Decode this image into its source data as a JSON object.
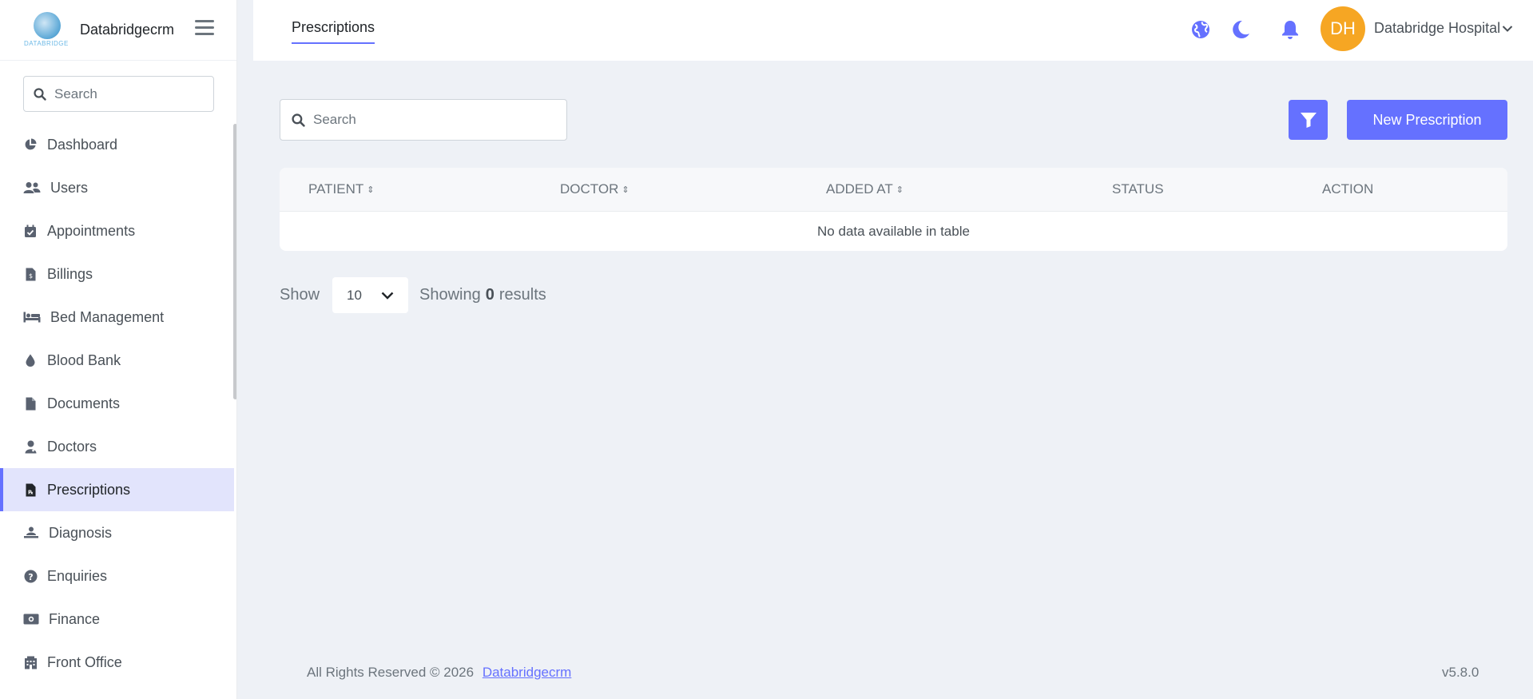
{
  "brand": {
    "name": "Databridgecrm",
    "logo_text": "DATABRIDGE"
  },
  "sidebar": {
    "search_placeholder": "Search",
    "items": [
      {
        "label": "Dashboard",
        "icon": "pie-chart-icon"
      },
      {
        "label": "Users",
        "icon": "users-icon"
      },
      {
        "label": "Appointments",
        "icon": "calendar-check-icon"
      },
      {
        "label": "Billings",
        "icon": "invoice-icon"
      },
      {
        "label": "Bed Management",
        "icon": "bed-icon"
      },
      {
        "label": "Blood Bank",
        "icon": "blood-drop-icon"
      },
      {
        "label": "Documents",
        "icon": "document-icon"
      },
      {
        "label": "Doctors",
        "icon": "doctor-icon"
      },
      {
        "label": "Prescriptions",
        "icon": "prescription-icon",
        "active": true
      },
      {
        "label": "Diagnosis",
        "icon": "diagnosis-icon"
      },
      {
        "label": "Enquiries",
        "icon": "question-circle-icon"
      },
      {
        "label": "Finance",
        "icon": "money-icon"
      },
      {
        "label": "Front Office",
        "icon": "building-icon"
      }
    ]
  },
  "header": {
    "tab": "Prescriptions",
    "avatar_initials": "DH",
    "user_name": "Databridge Hospital"
  },
  "main": {
    "search_placeholder": "Search",
    "new_button": "New Prescription",
    "columns": [
      "PATIENT",
      "DOCTOR",
      "ADDED AT",
      "STATUS",
      "ACTION"
    ],
    "empty_message": "No data available in table",
    "pager": {
      "show_label": "Show",
      "page_size": "10",
      "showing_prefix": "Showing",
      "count": "0",
      "showing_suffix": "results"
    }
  },
  "footer": {
    "copyright": "All Rights Reserved © 2026",
    "link": "Databridgecrm",
    "version": "v5.8.0"
  },
  "colors": {
    "accent": "#6571ff",
    "avatar": "#f6a623",
    "active_bg": "#e2e4fc",
    "background": "#eef1f6"
  }
}
